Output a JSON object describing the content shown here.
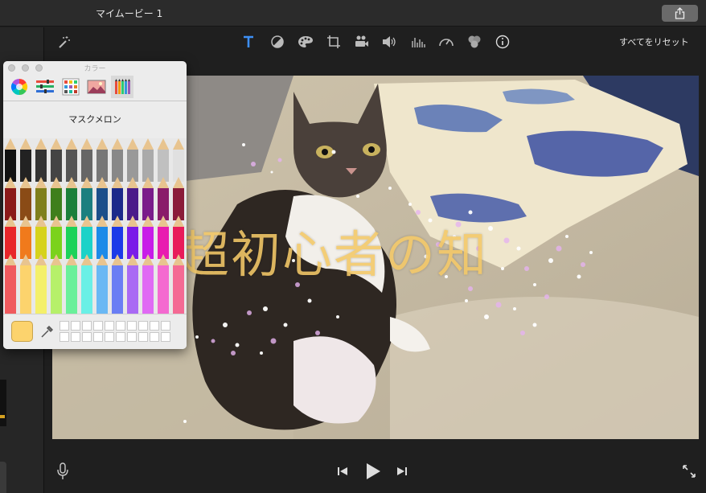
{
  "window": {
    "title": "マイムービー 1"
  },
  "toolbar": {
    "reset_all_label": "すべてをリセット"
  },
  "color_panel": {
    "title": "カラー",
    "selected_color_name": "マスクメロン",
    "selected_color": "#fcd36d",
    "modes": [
      "color-wheel-icon",
      "color-sliders-icon",
      "color-palettes-icon",
      "image-palettes-icon",
      "pencils-icon"
    ]
  },
  "viewer": {
    "title_text": "超初心者の知"
  },
  "colors": {
    "accent_blue": "#3d8ff5",
    "title_gold": "#f4c968"
  }
}
